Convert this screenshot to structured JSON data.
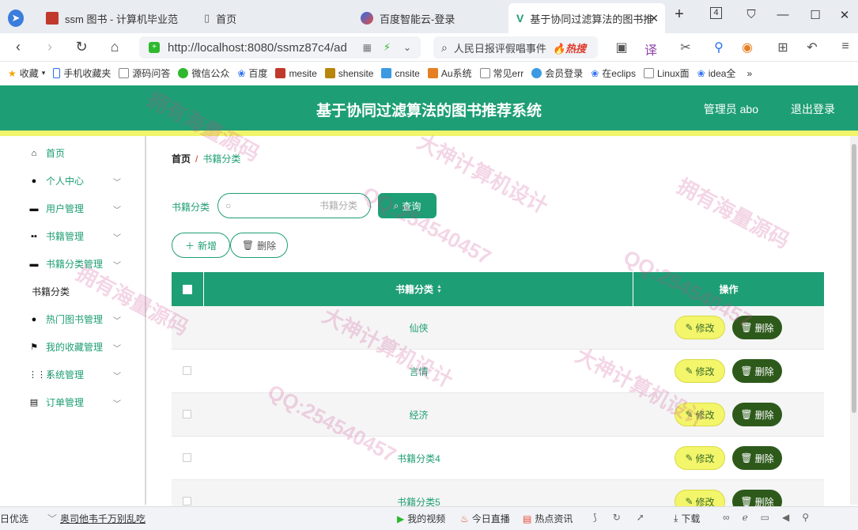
{
  "browser": {
    "tabs": [
      {
        "label": "ssm 图书 - 计算机毕业范",
        "icon": "red-square-icon"
      },
      {
        "label": "首页",
        "icon": "page-icon"
      },
      {
        "label": "百度智能云-登录",
        "icon": "baidu-cloud-icon"
      },
      {
        "label": "基于协同过滤算法的图书推",
        "icon": "vue-icon"
      }
    ],
    "new_tab": "+",
    "tab_count": "4",
    "url": "http://localhost:8080/ssmz87c4/ad",
    "search_text": "人民日报评假唱事件",
    "search_hot": "🔥热搜",
    "bookmarks": [
      "收藏",
      "手机收藏夹",
      "源码问答",
      "微信公众",
      "百度",
      "mesite",
      "shensite",
      "cnsite",
      "Au系统",
      "常见err",
      "会员登录",
      "在eclips",
      "Linux面",
      "idea全"
    ],
    "bookmarks_more": "»"
  },
  "app": {
    "title": "基于协同过滤算法的图书推荐系统",
    "user": "管理员 abo",
    "logout": "退出登录",
    "accent": "#1e9e74"
  },
  "sidebar": {
    "items": [
      {
        "label": "首页",
        "icon": "home-icon",
        "chevron": false
      },
      {
        "label": "个人中心",
        "icon": "user-icon",
        "chevron": true
      },
      {
        "label": "用户管理",
        "icon": "users-icon",
        "chevron": true
      },
      {
        "label": "书籍管理",
        "icon": "grid-icon",
        "chevron": true
      },
      {
        "label": "书籍分类管理",
        "icon": "monitor-icon",
        "chevron": true
      },
      {
        "label": "书籍分类",
        "icon": "",
        "chevron": false,
        "sub": true
      },
      {
        "label": "热门图书管理",
        "icon": "bulb-icon",
        "chevron": true
      },
      {
        "label": "我的收藏管理",
        "icon": "flag-icon",
        "chevron": true
      },
      {
        "label": "系统管理",
        "icon": "apps-icon",
        "chevron": true
      },
      {
        "label": "订单管理",
        "icon": "clipboard-icon",
        "chevron": true
      }
    ]
  },
  "breadcrumb": {
    "home": "首页",
    "sep": "/",
    "current": "书籍分类"
  },
  "filter": {
    "label": "书籍分类",
    "placeholder": "书籍分类",
    "query": "查询"
  },
  "actions": {
    "add": "新增",
    "delete": "删除"
  },
  "table": {
    "headers": {
      "name": "书籍分类",
      "sort": "▲▼",
      "ops": "操作"
    },
    "rows": [
      {
        "name": "仙侠"
      },
      {
        "name": "言情"
      },
      {
        "name": "经济"
      },
      {
        "name": "书籍分类4"
      },
      {
        "name": "书籍分类5"
      }
    ],
    "edit_label": "修改",
    "delete_label": "删除"
  },
  "statusbar": {
    "left_text": "日优选",
    "news": "奥司他韦千万别乱吃",
    "video": "我的视频",
    "live": "今日直播",
    "hot_news": "热点资讯",
    "download": "下载"
  },
  "watermarks": [
    "拥有海量源码",
    "大神计算机设计",
    "QQ:254540457",
    "拥有海量源码",
    "大神计算机设计",
    "QQ:254540457",
    "拥有海量源码",
    "QQ:254540457",
    "大神计算机设计"
  ]
}
